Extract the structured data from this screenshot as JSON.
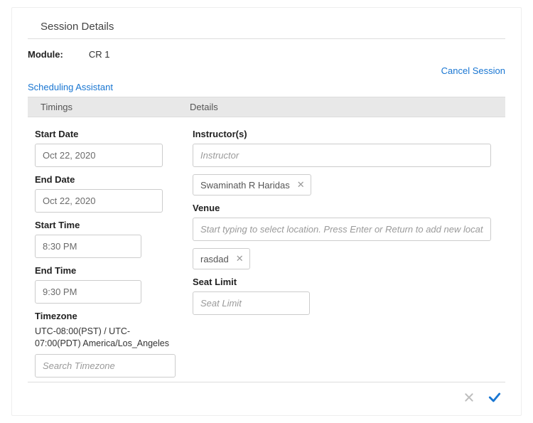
{
  "header": {
    "title": "Session Details"
  },
  "module": {
    "label": "Module:",
    "value": "CR 1"
  },
  "actions": {
    "cancel_session": "Cancel Session",
    "scheduling_assistant": "Scheduling Assistant"
  },
  "columns": {
    "timings": "Timings",
    "details": "Details"
  },
  "timings": {
    "start_date": {
      "label": "Start Date",
      "value": "Oct 22, 2020"
    },
    "end_date": {
      "label": "End Date",
      "value": "Oct 22, 2020"
    },
    "start_time": {
      "label": "Start Time",
      "value": "8:30 PM"
    },
    "end_time": {
      "label": "End Time",
      "value": "9:30 PM"
    },
    "timezone": {
      "label": "Timezone",
      "display": "UTC-08:00(PST) / UTC-07:00(PDT) America/Los_Angeles",
      "placeholder": "Search Timezone"
    }
  },
  "details": {
    "instructors": {
      "label": "Instructor(s)",
      "placeholder": "Instructor",
      "chips": [
        {
          "name": "Swaminath R Haridas"
        }
      ]
    },
    "venue": {
      "label": "Venue",
      "placeholder": "Start typing to select location. Press Enter or Return to add new location",
      "chips": [
        {
          "name": "rasdad"
        }
      ]
    },
    "seat_limit": {
      "label": "Seat Limit",
      "placeholder": "Seat Limit"
    }
  },
  "icons": {
    "close": "close-icon",
    "confirm": "check-icon",
    "chip_remove": "chip-remove-icon"
  }
}
